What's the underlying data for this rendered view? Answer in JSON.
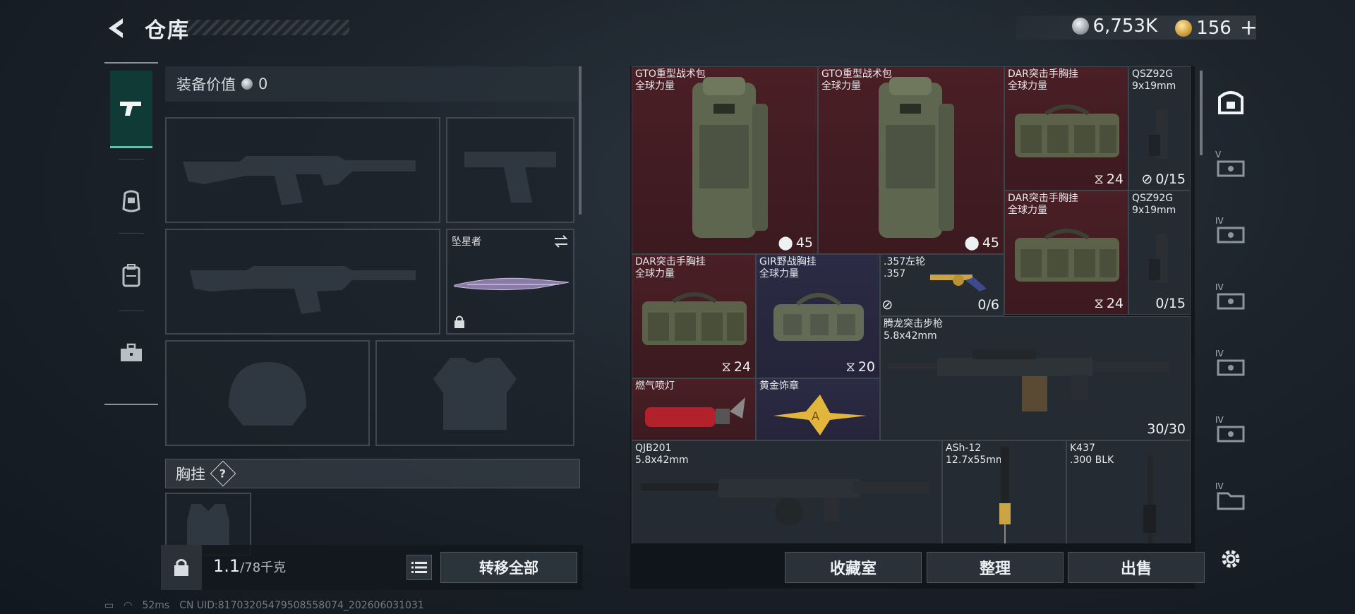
{
  "header": {
    "title": "仓库"
  },
  "currency": {
    "silver": "6,753K",
    "gold": "156",
    "plus": "+"
  },
  "left_nav": {
    "items": [
      "weapons",
      "armor",
      "backpack",
      "case"
    ]
  },
  "loadout": {
    "equip_value_label": "装备价值",
    "equip_value": "0",
    "melee_name": "坠星者",
    "chest_label": "胸挂",
    "chest_help": "?",
    "weight_current": "1.1",
    "weight_max": "/78千克",
    "transfer_all": "转移全部"
  },
  "stash": {
    "items": [
      {
        "name": "GTO重型战术包",
        "sub": "全球力量",
        "count": "45"
      },
      {
        "name": "GTO重型战术包",
        "sub": "全球力量",
        "count": "45"
      },
      {
        "name": "DAR突击手胸挂",
        "sub": "全球力量",
        "count": "24"
      },
      {
        "name": "QSZ92G",
        "sub": "9x19mm",
        "count": "0/15"
      },
      {
        "name": "DAR突击手胸挂",
        "sub": "全球力量",
        "count": "24"
      },
      {
        "name": "QSZ92G",
        "sub": "9x19mm",
        "count": "0/15"
      },
      {
        "name": "DAR突击手胸挂",
        "sub": "全球力量",
        "count": "24"
      },
      {
        "name": "GIR野战胸挂",
        "sub": "全球力量",
        "count": "20"
      },
      {
        "name": ".357左轮",
        "sub": ".357",
        "count": "0/6"
      },
      {
        "name": "腾龙突击步枪",
        "sub": "5.8x42mm",
        "count": "30/30"
      },
      {
        "name": "燃气喷灯",
        "sub": "",
        "count": ""
      },
      {
        "name": "黄金饰章",
        "sub": "",
        "count": ""
      },
      {
        "name": "QJB201",
        "sub": "5.8x42mm",
        "count": ""
      },
      {
        "name": "ASh-12",
        "sub": "12.7x55mm",
        "count": ""
      },
      {
        "name": "K437",
        "sub": ".300 BLK",
        "count": ""
      }
    ],
    "buttons": {
      "collection": "收藏室",
      "sort": "整理",
      "sell": "出售"
    }
  },
  "filters": {
    "levels": [
      "V",
      "IV",
      "IV",
      "IV",
      "IV",
      "IV"
    ]
  },
  "status": {
    "ping": "52ms",
    "uid": "CN UID:81703205479508558074_202606031031"
  },
  "colors": {
    "accent": "#2fd7b0",
    "red_rarity": "#4a1f25",
    "purple_rarity": "#2c2b45"
  }
}
